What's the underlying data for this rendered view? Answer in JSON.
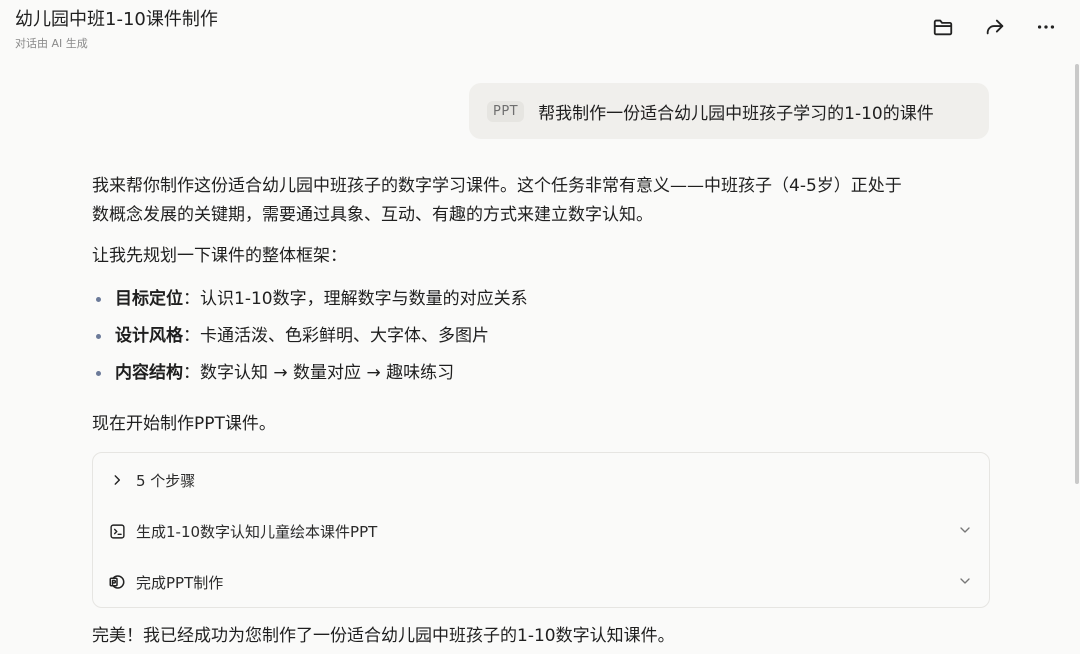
{
  "header": {
    "title": "幼儿园中班1-10课件制作",
    "subtitle": "对话由 AI 生成",
    "icons": [
      "folder-icon",
      "share-icon",
      "more-icon"
    ]
  },
  "user_message": {
    "badge": "PPT",
    "text": "帮我制作一份适合幼儿园中班孩子学习的1-10的课件"
  },
  "assistant": {
    "intro_line1": "我来帮你制作这份适合幼儿园中班孩子的数字学习课件。这个任务非常有意义——中班孩子（4-5岁）正处于",
    "intro_line2": "数概念发展的关键期，需要通过具象、互动、有趣的方式来建立数字认知。",
    "plan_intro": "让我先规划一下课件的整体框架：",
    "bullets": [
      {
        "label": "目标定位",
        "text": "：认识1-10数字，理解数字与数量的对应关系"
      },
      {
        "label": "设计风格",
        "text": "：卡通活泼、色彩鲜明、大字体、多图片"
      },
      {
        "label": "内容结构",
        "text": "：数字认知 → 数量对应 → 趣味练习"
      }
    ],
    "start_text": "现在开始制作PPT课件。",
    "steps": {
      "summary": "5 个步骤",
      "items": [
        {
          "label": "生成1-10数字认知儿童绘本课件PPT",
          "icon": "terminal-icon"
        },
        {
          "label": "完成PPT制作",
          "icon": "ppt-file-icon"
        }
      ]
    },
    "final_text": "完美！我已经成功为您制作了一份适合幼儿园中班孩子的1-10数字认知课件。"
  }
}
